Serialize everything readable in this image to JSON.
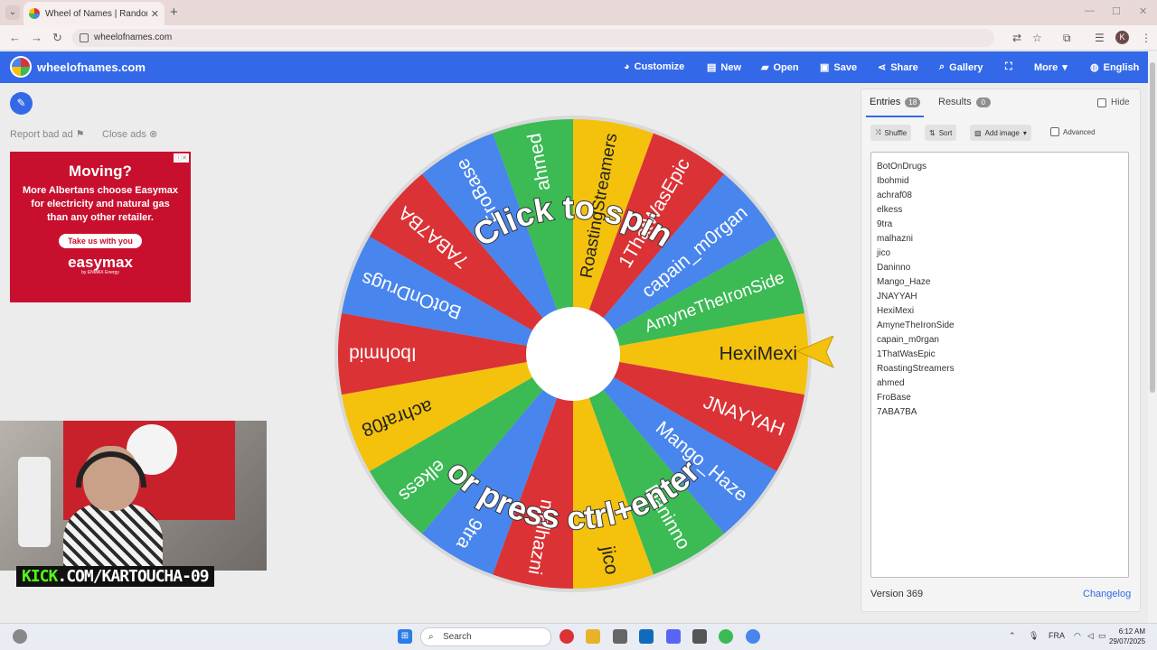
{
  "browser": {
    "tab_title": "Wheel of Names | Random nam",
    "tab_close": "✕",
    "new_tab": "+",
    "url": "wheelofnames.com",
    "profile_letter": "K"
  },
  "header": {
    "brand": "wheelofnames.com",
    "nav": {
      "customize": "Customize",
      "new": "New",
      "open": "Open",
      "save": "Save",
      "share": "Share",
      "gallery": "Gallery",
      "more": "More",
      "language": "English"
    }
  },
  "ads": {
    "report": "Report bad ad",
    "close": "Close ads",
    "headline": "Moving?",
    "body": "More Albertans choose Easymax for electricity and natural gas than any other retailer.",
    "cta": "Take us with you",
    "logo": "easymax",
    "logo_sub": "by ENMAX Energy"
  },
  "stream": {
    "channel_prefix": "KICK",
    "channel_rest": ".COM/KARTOUCHA-09"
  },
  "wheel": {
    "prompt_top": "Click to spin",
    "prompt_bottom": "or press ctrl+enter",
    "segments": [
      {
        "label": "HexiMexi",
        "color": "#f4c20d"
      },
      {
        "label": "JNAYYAH",
        "color": "#db3236"
      },
      {
        "label": "Mango_Haze",
        "color": "#4885ed"
      },
      {
        "label": "Daninno",
        "color": "#3cba54"
      },
      {
        "label": "jico",
        "color": "#f4c20d"
      },
      {
        "label": "malhazni",
        "color": "#db3236"
      },
      {
        "label": "9tra",
        "color": "#4885ed"
      },
      {
        "label": "elkess",
        "color": "#3cba54"
      },
      {
        "label": "achraf08",
        "color": "#f4c20d"
      },
      {
        "label": "Ibohmid",
        "color": "#db3236"
      },
      {
        "label": "BotOnDrugs",
        "color": "#4885ed"
      },
      {
        "label": "7ABA7BA",
        "color": "#db3236"
      },
      {
        "label": "FroBase",
        "color": "#4885ed"
      },
      {
        "label": "ahmed",
        "color": "#3cba54"
      },
      {
        "label": "RoastingStreamers",
        "color": "#f4c20d"
      },
      {
        "label": "1ThatWasEpic",
        "color": "#db3236"
      },
      {
        "label": "capain_m0rgan",
        "color": "#4885ed"
      },
      {
        "label": "AmyneTheIronSide",
        "color": "#3cba54"
      }
    ],
    "pointer_color": "#f4c20d"
  },
  "panel": {
    "tab_entries": "Entries",
    "entries_count": "18",
    "tab_results": "Results",
    "results_count": "0",
    "hide": "Hide",
    "shuffle": "Shuffle",
    "sort": "Sort",
    "add_image": "Add image",
    "advanced": "Advanced",
    "entries": [
      "BotOnDrugs",
      "Ibohmid",
      "achraf08",
      "elkess",
      "9tra",
      "malhazni",
      "jico",
      "Daninno",
      "Mango_Haze",
      "JNAYYAH",
      "HexiMexi",
      "AmyneTheIronSide",
      "capain_m0rgan",
      "1ThatWasEpic",
      "RoastingStreamers",
      "ahmed",
      "FroBase",
      "7ABA7BA"
    ],
    "version": "Version 369",
    "changelog": "Changelog"
  },
  "taskbar": {
    "search": "Search",
    "language": "FRA",
    "time": "6:12 AM",
    "date": "29/07/2025"
  },
  "colors": {
    "accent": "#3369e8",
    "red": "#db3236",
    "blue": "#4885ed",
    "green": "#3cba54",
    "yellow": "#f4c20d"
  }
}
